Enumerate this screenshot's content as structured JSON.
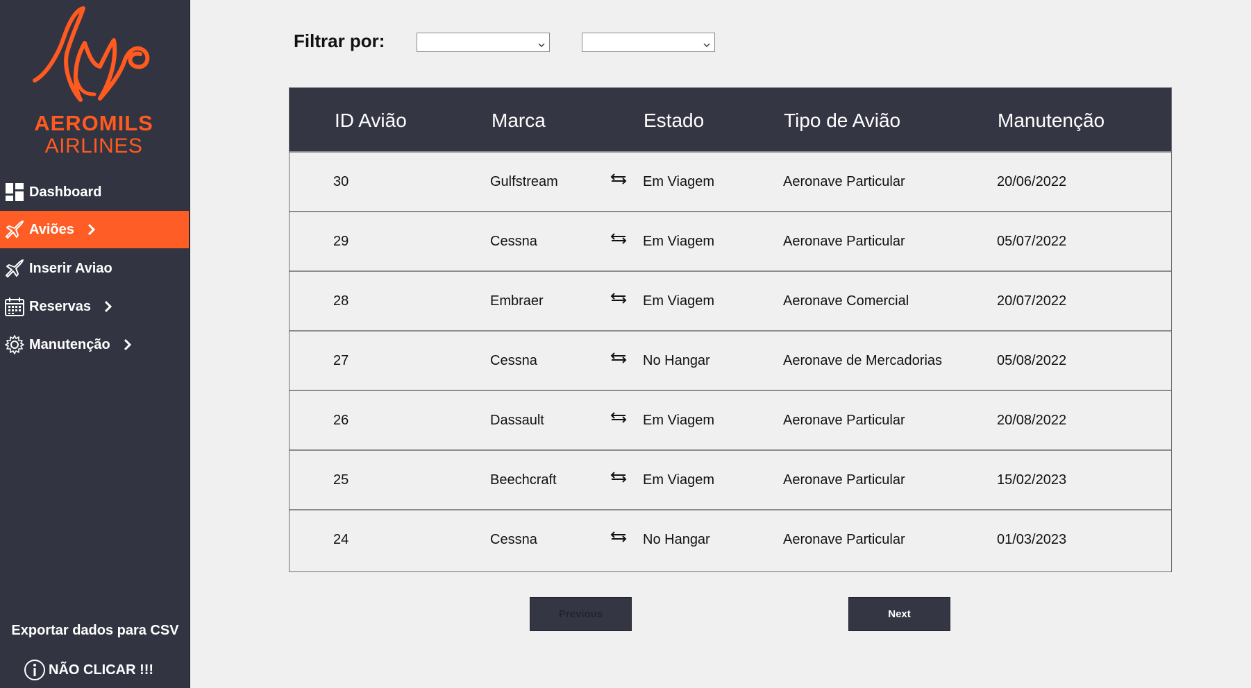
{
  "brand": {
    "line1": "AEROMILS",
    "line2": "AIRLINES",
    "color": "#ff5a1f"
  },
  "sidebar": {
    "items": [
      {
        "label": "Dashboard",
        "icon": "dashboard-icon",
        "active": false,
        "chevron": false
      },
      {
        "label": "Aviões",
        "icon": "airplane-icon",
        "active": true,
        "chevron": true
      },
      {
        "label": "Inserir Aviao",
        "icon": "airplane-icon",
        "active": false,
        "chevron": false
      },
      {
        "label": "Reservas",
        "icon": "calendar-icon",
        "active": false,
        "chevron": true
      },
      {
        "label": "Manutenção",
        "icon": "gear-icon",
        "active": false,
        "chevron": true
      }
    ],
    "export_label": "Exportar dados para CSV",
    "no_click_label": "NÃO CLICAR !!!"
  },
  "filter": {
    "label": "Filtrar por:",
    "select1_value": "",
    "select2_value": ""
  },
  "table": {
    "headers": [
      "ID Avião",
      "Marca",
      "Estado",
      "Tipo de Avião",
      "Manutenção"
    ],
    "rows": [
      [
        "30",
        "Gulfstream",
        "Em Viagem",
        "Aeronave Particular",
        "20/06/2022"
      ],
      [
        "29",
        "Cessna",
        "Em Viagem",
        "Aeronave Particular",
        "05/07/2022"
      ],
      [
        "28",
        "Embraer",
        "Em Viagem",
        "Aeronave Comercial",
        "20/07/2022"
      ],
      [
        "27",
        "Cessna",
        "No Hangar",
        "Aeronave de Mercadorias",
        "05/08/2022"
      ],
      [
        "26",
        "Dassault",
        "Em Viagem",
        "Aeronave Particular",
        "20/08/2022"
      ],
      [
        "25",
        "Beechcraft",
        "Em Viagem",
        "Aeronave Particular",
        "15/02/2023"
      ],
      [
        "24",
        "Cessna",
        "No Hangar",
        "Aeronave Particular",
        "01/03/2023"
      ]
    ]
  },
  "pagination": {
    "previous_label": "Previous",
    "next_label": "Next"
  },
  "colors": {
    "sidebar_bg": "#323441",
    "accent": "#ff5d26",
    "header_bg": "#353644",
    "page_bg": "#f0f0f0"
  }
}
